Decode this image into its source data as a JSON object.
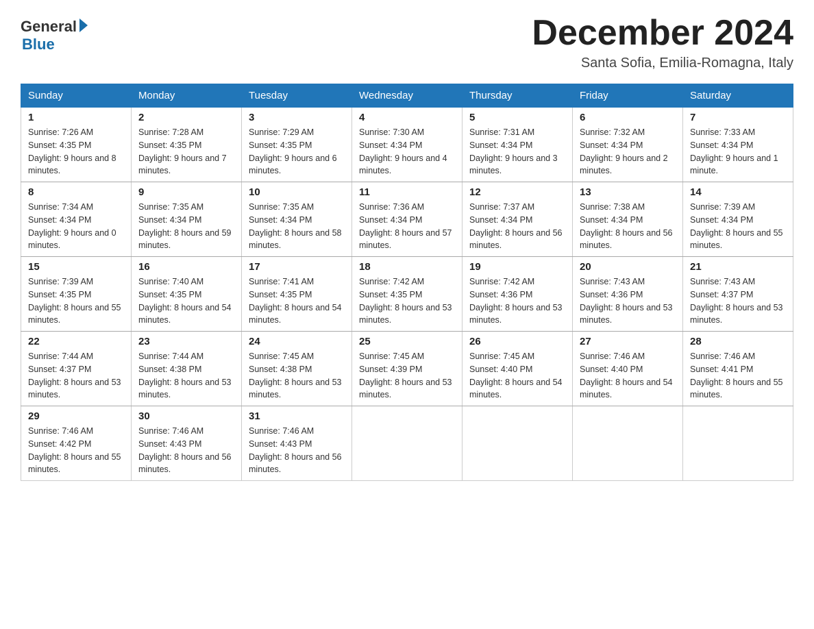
{
  "logo": {
    "general": "General",
    "blue": "Blue"
  },
  "title": "December 2024",
  "location": "Santa Sofia, Emilia-Romagna, Italy",
  "days_of_week": [
    "Sunday",
    "Monday",
    "Tuesday",
    "Wednesday",
    "Thursday",
    "Friday",
    "Saturday"
  ],
  "weeks": [
    [
      {
        "day": "1",
        "sunrise": "7:26 AM",
        "sunset": "4:35 PM",
        "daylight": "9 hours and 8 minutes."
      },
      {
        "day": "2",
        "sunrise": "7:28 AM",
        "sunset": "4:35 PM",
        "daylight": "9 hours and 7 minutes."
      },
      {
        "day": "3",
        "sunrise": "7:29 AM",
        "sunset": "4:35 PM",
        "daylight": "9 hours and 6 minutes."
      },
      {
        "day": "4",
        "sunrise": "7:30 AM",
        "sunset": "4:34 PM",
        "daylight": "9 hours and 4 minutes."
      },
      {
        "day": "5",
        "sunrise": "7:31 AM",
        "sunset": "4:34 PM",
        "daylight": "9 hours and 3 minutes."
      },
      {
        "day": "6",
        "sunrise": "7:32 AM",
        "sunset": "4:34 PM",
        "daylight": "9 hours and 2 minutes."
      },
      {
        "day": "7",
        "sunrise": "7:33 AM",
        "sunset": "4:34 PM",
        "daylight": "9 hours and 1 minute."
      }
    ],
    [
      {
        "day": "8",
        "sunrise": "7:34 AM",
        "sunset": "4:34 PM",
        "daylight": "9 hours and 0 minutes."
      },
      {
        "day": "9",
        "sunrise": "7:35 AM",
        "sunset": "4:34 PM",
        "daylight": "8 hours and 59 minutes."
      },
      {
        "day": "10",
        "sunrise": "7:35 AM",
        "sunset": "4:34 PM",
        "daylight": "8 hours and 58 minutes."
      },
      {
        "day": "11",
        "sunrise": "7:36 AM",
        "sunset": "4:34 PM",
        "daylight": "8 hours and 57 minutes."
      },
      {
        "day": "12",
        "sunrise": "7:37 AM",
        "sunset": "4:34 PM",
        "daylight": "8 hours and 56 minutes."
      },
      {
        "day": "13",
        "sunrise": "7:38 AM",
        "sunset": "4:34 PM",
        "daylight": "8 hours and 56 minutes."
      },
      {
        "day": "14",
        "sunrise": "7:39 AM",
        "sunset": "4:34 PM",
        "daylight": "8 hours and 55 minutes."
      }
    ],
    [
      {
        "day": "15",
        "sunrise": "7:39 AM",
        "sunset": "4:35 PM",
        "daylight": "8 hours and 55 minutes."
      },
      {
        "day": "16",
        "sunrise": "7:40 AM",
        "sunset": "4:35 PM",
        "daylight": "8 hours and 54 minutes."
      },
      {
        "day": "17",
        "sunrise": "7:41 AM",
        "sunset": "4:35 PM",
        "daylight": "8 hours and 54 minutes."
      },
      {
        "day": "18",
        "sunrise": "7:42 AM",
        "sunset": "4:35 PM",
        "daylight": "8 hours and 53 minutes."
      },
      {
        "day": "19",
        "sunrise": "7:42 AM",
        "sunset": "4:36 PM",
        "daylight": "8 hours and 53 minutes."
      },
      {
        "day": "20",
        "sunrise": "7:43 AM",
        "sunset": "4:36 PM",
        "daylight": "8 hours and 53 minutes."
      },
      {
        "day": "21",
        "sunrise": "7:43 AM",
        "sunset": "4:37 PM",
        "daylight": "8 hours and 53 minutes."
      }
    ],
    [
      {
        "day": "22",
        "sunrise": "7:44 AM",
        "sunset": "4:37 PM",
        "daylight": "8 hours and 53 minutes."
      },
      {
        "day": "23",
        "sunrise": "7:44 AM",
        "sunset": "4:38 PM",
        "daylight": "8 hours and 53 minutes."
      },
      {
        "day": "24",
        "sunrise": "7:45 AM",
        "sunset": "4:38 PM",
        "daylight": "8 hours and 53 minutes."
      },
      {
        "day": "25",
        "sunrise": "7:45 AM",
        "sunset": "4:39 PM",
        "daylight": "8 hours and 53 minutes."
      },
      {
        "day": "26",
        "sunrise": "7:45 AM",
        "sunset": "4:40 PM",
        "daylight": "8 hours and 54 minutes."
      },
      {
        "day": "27",
        "sunrise": "7:46 AM",
        "sunset": "4:40 PM",
        "daylight": "8 hours and 54 minutes."
      },
      {
        "day": "28",
        "sunrise": "7:46 AM",
        "sunset": "4:41 PM",
        "daylight": "8 hours and 55 minutes."
      }
    ],
    [
      {
        "day": "29",
        "sunrise": "7:46 AM",
        "sunset": "4:42 PM",
        "daylight": "8 hours and 55 minutes."
      },
      {
        "day": "30",
        "sunrise": "7:46 AM",
        "sunset": "4:43 PM",
        "daylight": "8 hours and 56 minutes."
      },
      {
        "day": "31",
        "sunrise": "7:46 AM",
        "sunset": "4:43 PM",
        "daylight": "8 hours and 56 minutes."
      },
      null,
      null,
      null,
      null
    ]
  ],
  "labels": {
    "sunrise": "Sunrise:",
    "sunset": "Sunset:",
    "daylight": "Daylight:"
  }
}
